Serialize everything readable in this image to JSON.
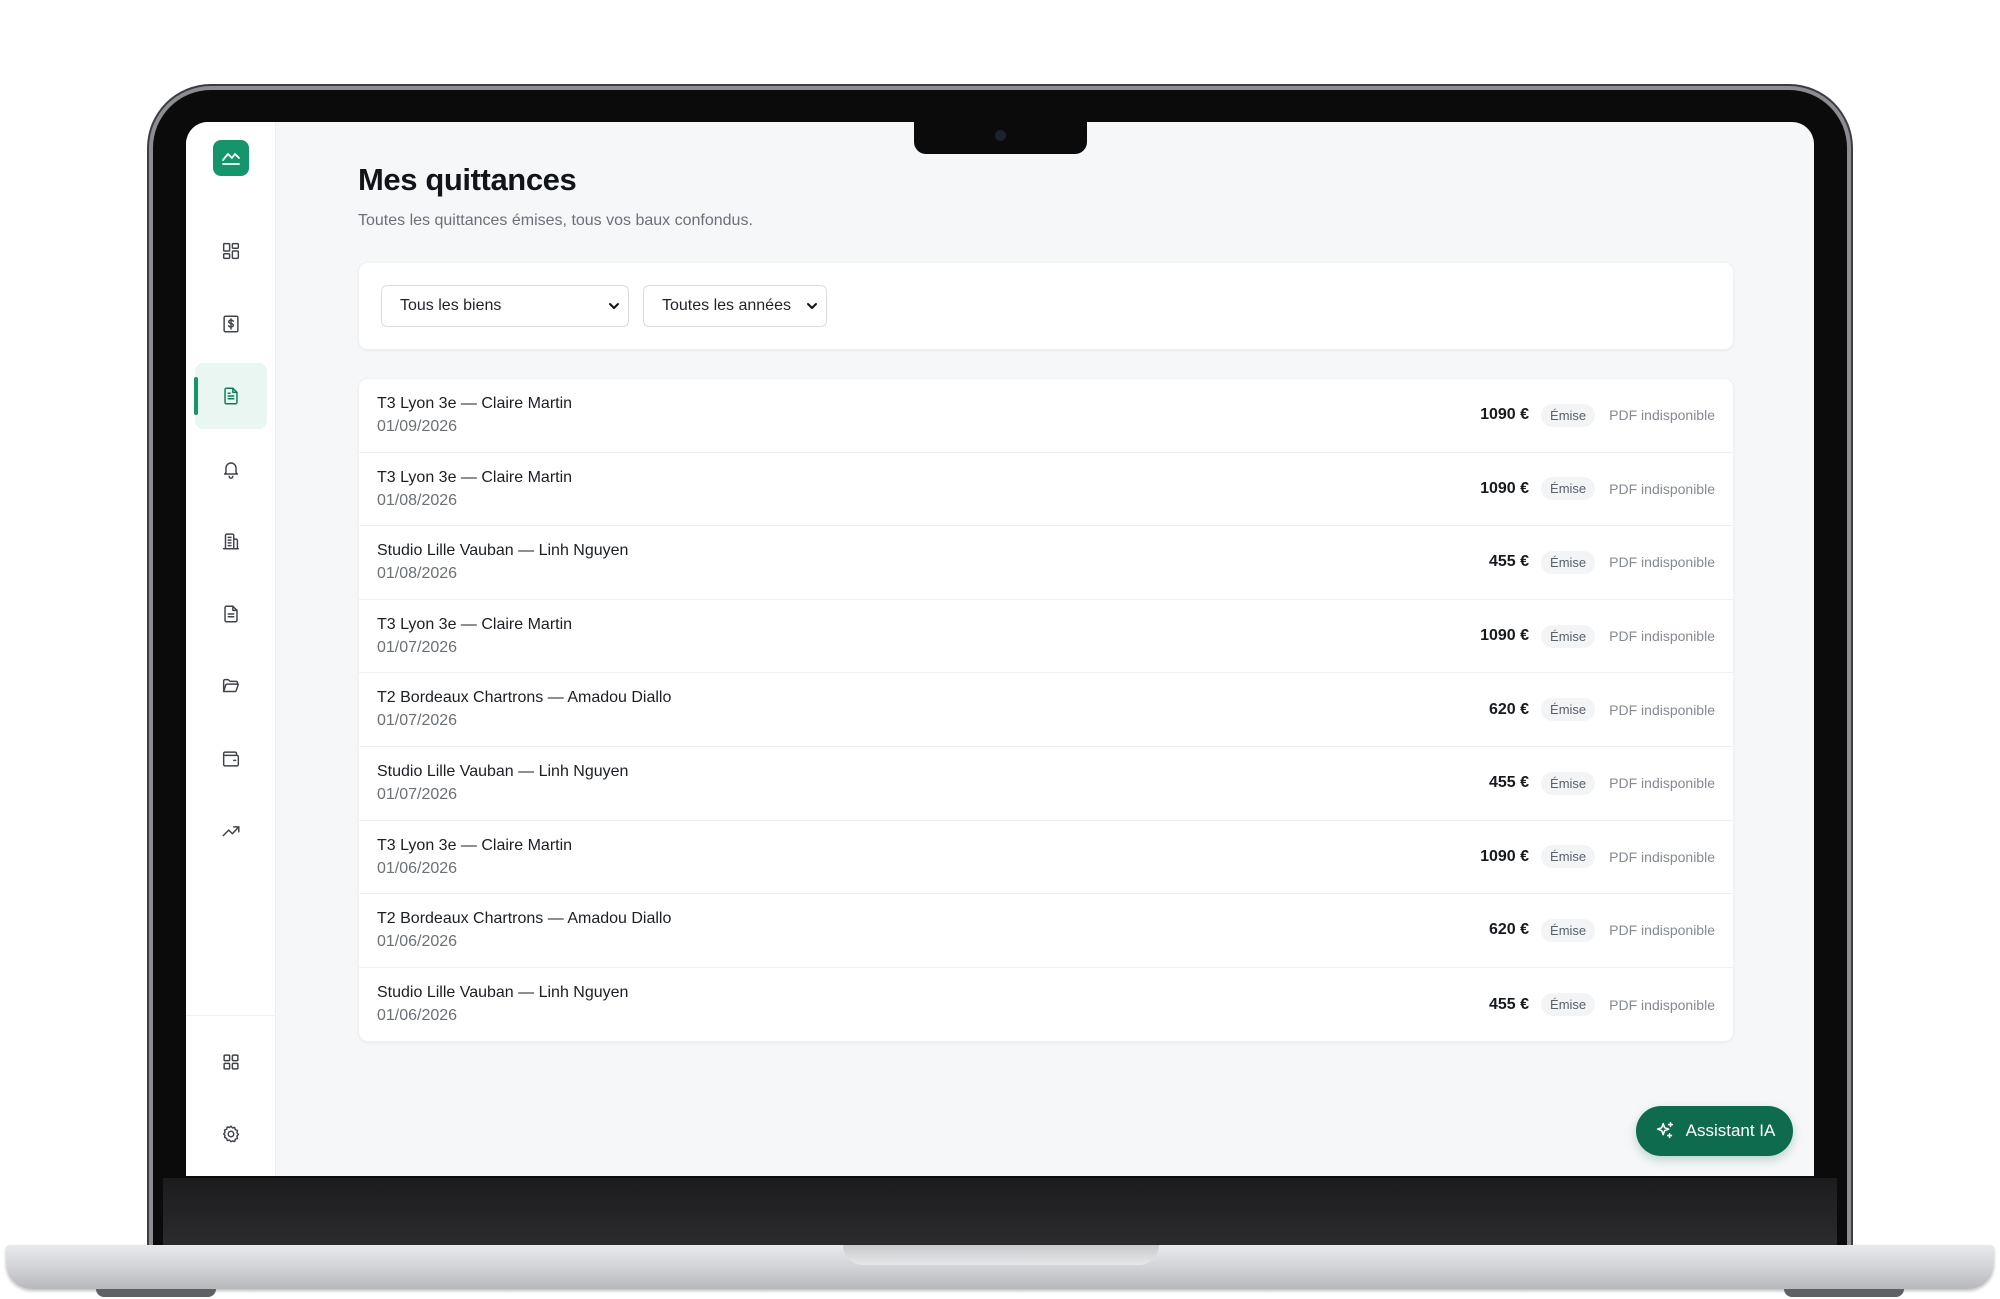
{
  "page": {
    "title": "Mes quittances",
    "subtitle": "Toutes les quittances émises, tous vos baux confondus."
  },
  "filters": {
    "property": "Tous les biens",
    "year": "Toutes les années"
  },
  "sidebar": {
    "items": [
      {
        "icon": "dashboard-icon"
      },
      {
        "icon": "payments-icon"
      },
      {
        "icon": "receipts-icon",
        "active": true
      },
      {
        "icon": "bell-icon"
      },
      {
        "icon": "building-icon"
      },
      {
        "icon": "document-icon"
      },
      {
        "icon": "folder-icon"
      },
      {
        "icon": "wallet-icon"
      },
      {
        "icon": "trending-up-icon"
      }
    ],
    "bottom": [
      {
        "icon": "apps-icon"
      },
      {
        "icon": "gear-icon"
      }
    ]
  },
  "receipts": [
    {
      "title": "T3 Lyon 3e — Claire Martin",
      "date": "01/09/2026",
      "amount": "1090 €",
      "status": "Émise",
      "pdf": "PDF indisponible"
    },
    {
      "title": "T3 Lyon 3e — Claire Martin",
      "date": "01/08/2026",
      "amount": "1090 €",
      "status": "Émise",
      "pdf": "PDF indisponible"
    },
    {
      "title": "Studio Lille Vauban — Linh Nguyen",
      "date": "01/08/2026",
      "amount": "455 €",
      "status": "Émise",
      "pdf": "PDF indisponible"
    },
    {
      "title": "T3 Lyon 3e — Claire Martin",
      "date": "01/07/2026",
      "amount": "1090 €",
      "status": "Émise",
      "pdf": "PDF indisponible"
    },
    {
      "title": "T2 Bordeaux Chartrons — Amadou Diallo",
      "date": "01/07/2026",
      "amount": "620 €",
      "status": "Émise",
      "pdf": "PDF indisponible"
    },
    {
      "title": "Studio Lille Vauban — Linh Nguyen",
      "date": "01/07/2026",
      "amount": "455 €",
      "status": "Émise",
      "pdf": "PDF indisponible"
    },
    {
      "title": "T3 Lyon 3e — Claire Martin",
      "date": "01/06/2026",
      "amount": "1090 €",
      "status": "Émise",
      "pdf": "PDF indisponible"
    },
    {
      "title": "T2 Bordeaux Chartrons — Amadou Diallo",
      "date": "01/06/2026",
      "amount": "620 €",
      "status": "Émise",
      "pdf": "PDF indisponible"
    },
    {
      "title": "Studio Lille Vauban — Linh Nguyen",
      "date": "01/06/2026",
      "amount": "455 €",
      "status": "Émise",
      "pdf": "PDF indisponible"
    }
  ],
  "assistant": {
    "label": "Assistant IA"
  },
  "colors": {
    "brand": "#15956b",
    "brand_dark": "#0f6b4d",
    "background": "#f6f7f9"
  }
}
